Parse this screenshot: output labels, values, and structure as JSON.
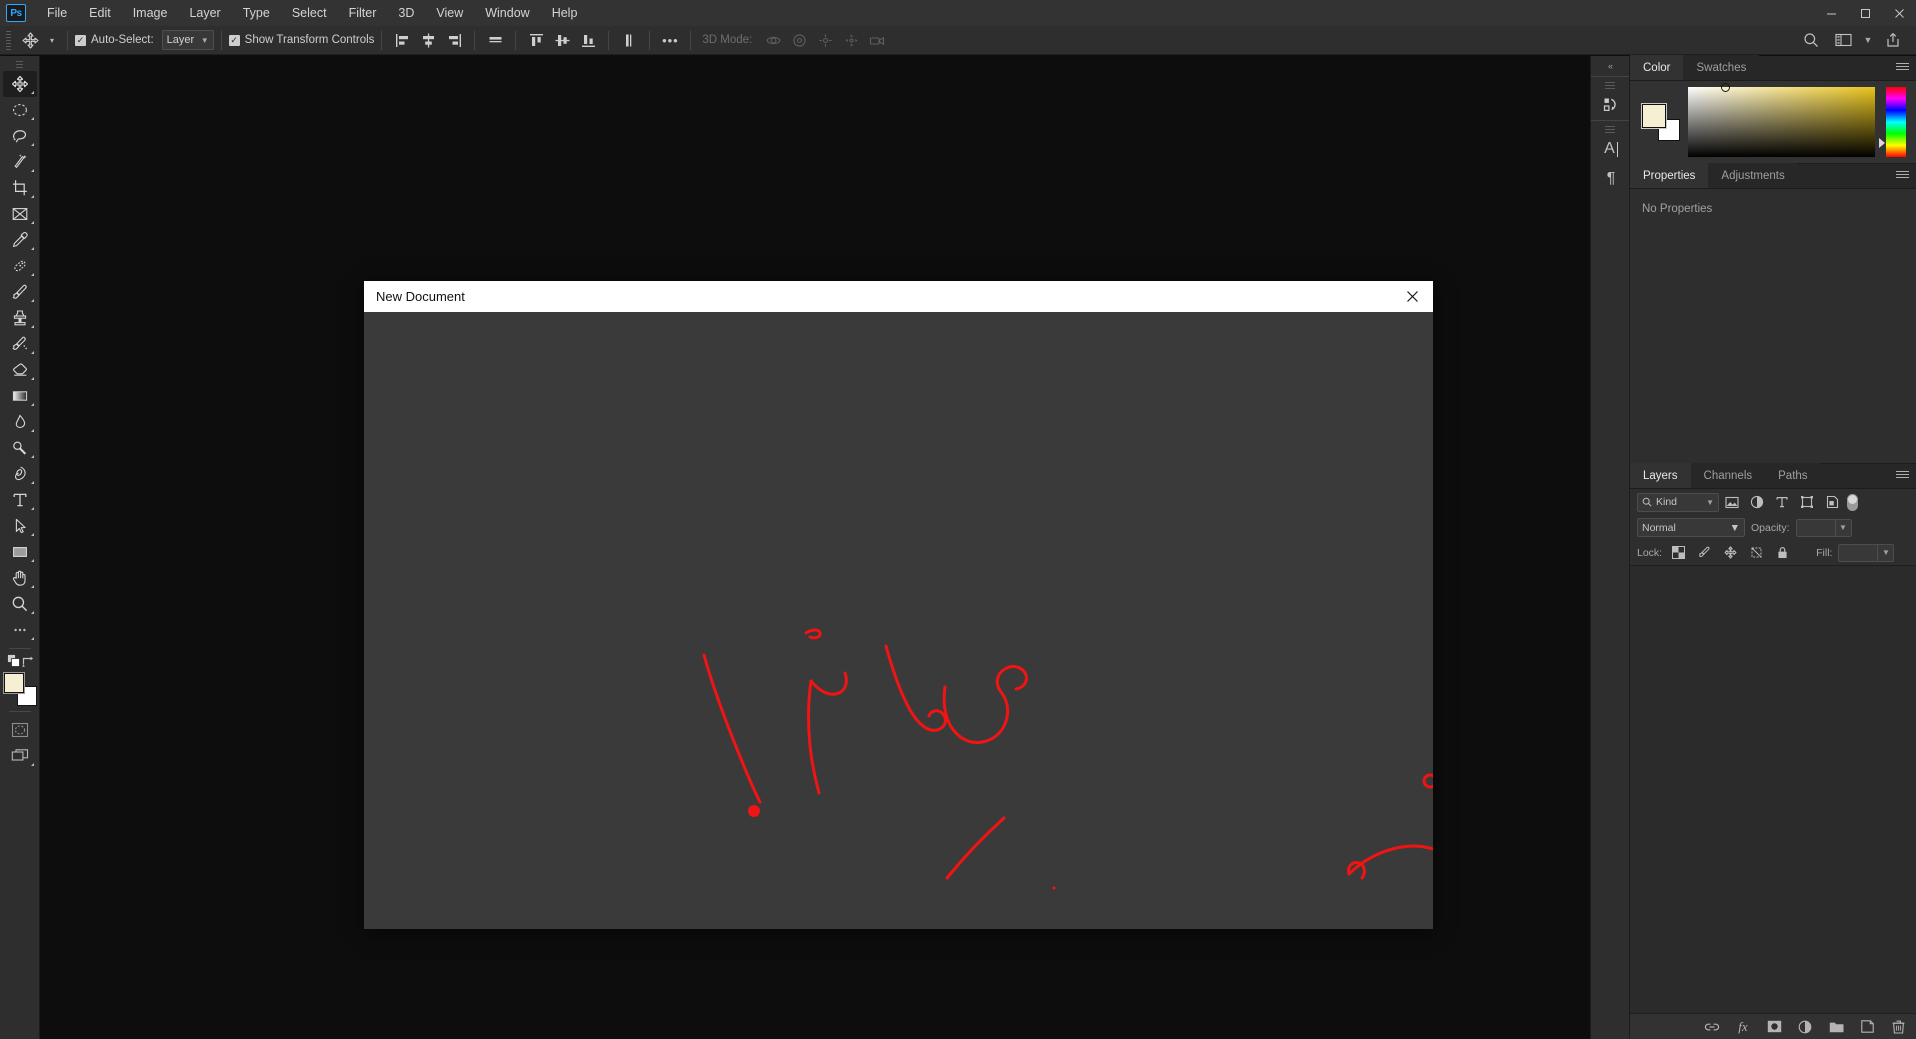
{
  "app": {
    "name": "Adobe Photoshop",
    "logo_text": "Ps"
  },
  "menubar": {
    "items": [
      "File",
      "Edit",
      "Image",
      "Layer",
      "Type",
      "Select",
      "Filter",
      "3D",
      "View",
      "Window",
      "Help"
    ],
    "window_controls": {
      "minimize": "—",
      "maximize": "❐",
      "close": "✕"
    }
  },
  "options_bar": {
    "tool_icon": "move-tool-icon",
    "auto_select_label": "Auto-Select:",
    "auto_select_checked": true,
    "auto_select_value": "Layer",
    "show_transform_label": "Show Transform Controls",
    "show_transform_checked": true,
    "more_label": "•••",
    "three_d_mode_label": "3D Mode:",
    "align_icons": [
      "align-left-edges-icon",
      "align-horizontal-centers-icon",
      "align-right-edges-icon",
      "distribute-horizontally-icon"
    ],
    "align_icons_2": [
      "align-top-edges-icon",
      "align-vertical-centers-icon",
      "align-bottom-edges-icon",
      "distribute-vertically-icon"
    ],
    "three_d_icons": [
      "3d-orbit-icon",
      "3d-roll-icon",
      "3d-pan-icon",
      "3d-slide-icon",
      "3d-camera-icon"
    ],
    "right_icons": [
      "search-icon",
      "workspace-icon",
      "chevron-down-icon",
      "share-icon"
    ]
  },
  "toolbar": {
    "tools": [
      {
        "name": "move-tool",
        "active": true
      },
      {
        "name": "marquee-tool",
        "active": false
      },
      {
        "name": "lasso-tool",
        "active": false
      },
      {
        "name": "magic-wand-tool",
        "active": false
      },
      {
        "name": "crop-tool",
        "active": false
      },
      {
        "name": "frame-tool",
        "active": false
      },
      {
        "name": "eyedropper-tool",
        "active": false
      },
      {
        "name": "healing-brush-tool",
        "active": false
      },
      {
        "name": "brush-tool",
        "active": false
      },
      {
        "name": "clone-stamp-tool",
        "active": false
      },
      {
        "name": "history-brush-tool",
        "active": false
      },
      {
        "name": "eraser-tool",
        "active": false
      },
      {
        "name": "gradient-tool",
        "active": false
      },
      {
        "name": "blur-tool",
        "active": false
      },
      {
        "name": "dodge-tool",
        "active": false
      },
      {
        "name": "pen-tool",
        "active": false
      },
      {
        "name": "type-tool",
        "active": false
      },
      {
        "name": "path-selection-tool",
        "active": false
      },
      {
        "name": "rectangle-tool",
        "active": false
      },
      {
        "name": "hand-tool",
        "active": false
      },
      {
        "name": "zoom-tool",
        "active": false
      },
      {
        "name": "edit-toolbar-tool",
        "active": false
      }
    ],
    "foreground_color": "#F7EFD3",
    "background_color": "#FFFFFF",
    "quick_mask": "quick-mask-icon",
    "screen_mode": "screen-mode-icon"
  },
  "dialog": {
    "title": "New Document",
    "close_label": "✕",
    "drawing": {
      "description": "handwritten red annotation over dialog body",
      "stroke_color": "#F01414",
      "stroke_width": 3
    }
  },
  "rail": {
    "collapse": "«",
    "icons": [
      "history-icon",
      "character-icon",
      "paragraph-icon"
    ],
    "character_glyph": "A",
    "paragraph_glyph": "¶"
  },
  "panels": {
    "color": {
      "tabs": [
        {
          "label": "Color",
          "active": true
        },
        {
          "label": "Swatches",
          "active": false
        }
      ],
      "foreground_color": "#F7EFD3",
      "background_color": "#FFFFFF",
      "picker_hue": "#E8C41D"
    },
    "properties": {
      "tabs": [
        {
          "label": "Properties",
          "active": true
        },
        {
          "label": "Adjustments",
          "active": false
        }
      ],
      "empty_text": "No Properties"
    },
    "layers": {
      "tabs": [
        {
          "label": "Layers",
          "active": true
        },
        {
          "label": "Channels",
          "active": false
        },
        {
          "label": "Paths",
          "active": false
        }
      ],
      "filter_label": "Kind",
      "filter_icons": [
        "pixel-layer-filter-icon",
        "adjustment-layer-filter-icon",
        "type-layer-filter-icon",
        "shape-layer-filter-icon",
        "smart-object-filter-icon"
      ],
      "blend_mode": "Normal",
      "opacity_label": "Opacity:",
      "opacity_value": "",
      "lock_label": "Lock:",
      "fill_label": "Fill:",
      "fill_value": "",
      "lock_icons": [
        "lock-transparent-pixels-icon",
        "lock-image-pixels-icon",
        "lock-position-icon",
        "lock-artboard-icon",
        "lock-all-icon"
      ],
      "bottom_icons": [
        "link-layers-icon",
        "layer-style-fx-icon",
        "add-layer-mask-icon",
        "new-adjustment-layer-icon",
        "new-group-icon",
        "new-layer-icon",
        "delete-layer-icon"
      ],
      "fx_label": "fx"
    }
  }
}
